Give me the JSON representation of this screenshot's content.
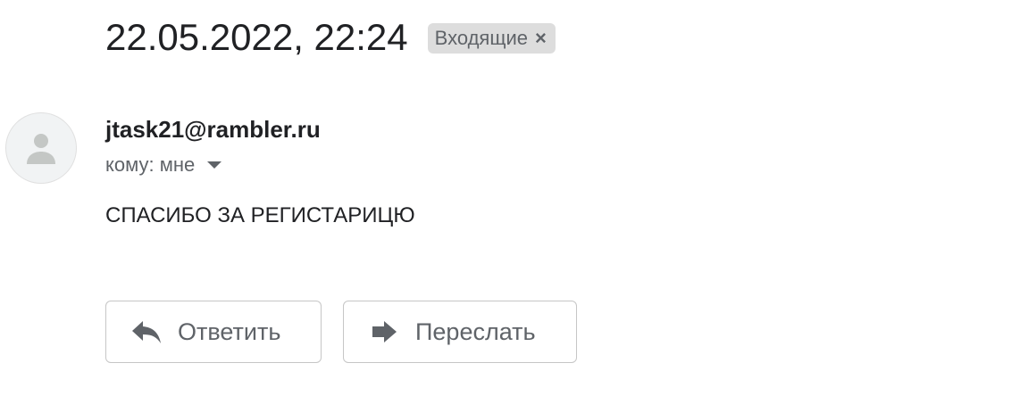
{
  "message": {
    "subject": "22.05.2022, 22:24",
    "label": {
      "text": "Входящие",
      "close_glyph": "×"
    },
    "sender": "jtask21@rambler.ru",
    "recipient": "кому: мне",
    "body": "СПАСИБО ЗА РЕГИСТАРИЦЮ"
  },
  "actions": {
    "reply_label": "Ответить",
    "forward_label": "Переслать"
  },
  "icons": {
    "avatar": "person-icon",
    "reply": "reply-arrow-icon",
    "forward": "forward-arrow-icon",
    "recipient_caret": "caret-down-icon",
    "label_close": "close-icon"
  },
  "colors": {
    "text_primary": "#202124",
    "text_secondary": "#5f6368",
    "chip_background": "#dddddd",
    "button_border": "#c6c6c6",
    "avatar_background": "#f1f3f4"
  }
}
